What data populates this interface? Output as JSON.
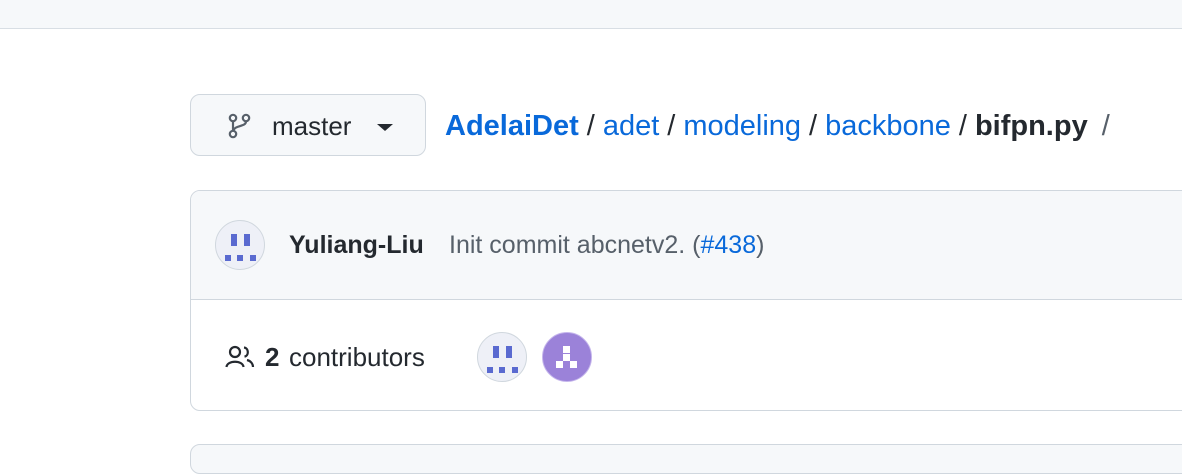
{
  "branch": {
    "name": "master",
    "icon": "git-branch-icon"
  },
  "breadcrumb": {
    "repo": "AdelaiDet",
    "dirs": [
      "adet",
      "modeling",
      "backbone"
    ],
    "file": "bifpn.py",
    "separator": "/"
  },
  "commit": {
    "author": "Yuliang-Liu",
    "message_prefix": "Init commit abcnetv2. (",
    "pr_link": "#438",
    "message_suffix": ")"
  },
  "contributors": {
    "icon": "people-icon",
    "count": "2",
    "label": "contributors"
  },
  "colors": {
    "link": "#0969da",
    "text": "#24292f",
    "muted": "#57606a",
    "border": "#d0d7de",
    "header_bg": "#f6f8fa"
  }
}
